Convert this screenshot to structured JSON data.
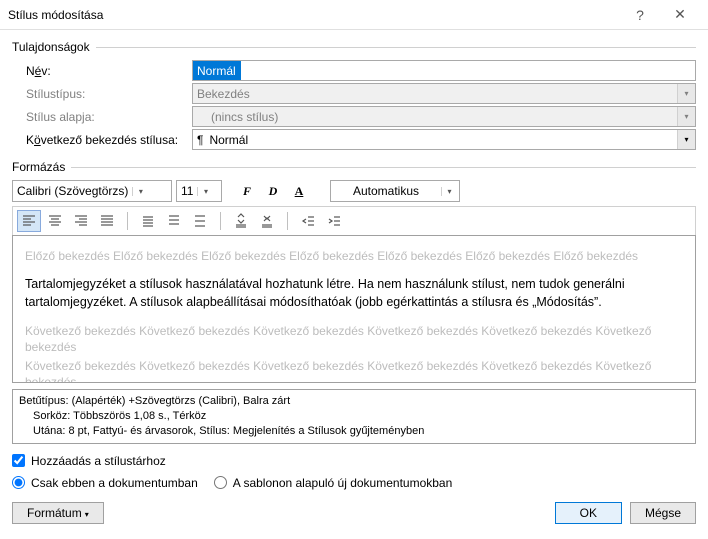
{
  "titlebar": {
    "title": "Stílus módosítása",
    "help": "?",
    "close": "✕"
  },
  "sections": {
    "properties": "Tulajdonságok",
    "formatting": "Formázás"
  },
  "props": {
    "name_label_pre": "N",
    "name_label_u": "é",
    "name_label_post": "v:",
    "name_value": "Normál",
    "type_label": "Stílustípus:",
    "type_value": "Bekezdés",
    "based_label": "Stílus alapja:",
    "based_value": "(nincs stílus)",
    "next_label_pre": "K",
    "next_label_u": "ö",
    "next_label_post": "vetkező bekezdés stílusa:",
    "next_value": "Normál"
  },
  "toolbar": {
    "font": "Calibri (Szövegtörzs)",
    "size": "11",
    "bold": "F",
    "italic": "D",
    "underline": "A",
    "auto": "Automatikus"
  },
  "preview": {
    "prev_line": "Előző bekezdés Előző bekezdés Előző bekezdés Előző bekezdés Előző bekezdés Előző bekezdés Előző bekezdés",
    "live": "Tartalomjegyzéket a stílusok használatával hozhatunk létre. Ha nem használunk stílust, nem tudok generálni tartalomjegyzéket. A stílusok alapbeállításai módosíthatóak (jobb egérkattintás a stílusra és „Módosítás”.",
    "next_line1": "Következő bekezdés Következő bekezdés Következő bekezdés Következő bekezdés Következő bekezdés Következő bekezdés",
    "next_line2": "Következő bekezdés Következő bekezdés Következő bekezdés Következő bekezdés Következő bekezdés Következő bekezdés"
  },
  "desc": {
    "line1": "Betűtípus: (Alapérték) +Szövegtörzs (Calibri), Balra zárt",
    "line2": "Sorköz:  Többszörös 1,08 s., Térköz",
    "line3": "Utána:  8 pt, Fattyú- és árvasorok, Stílus: Megjelenítés a Stílusok gyűjteményben"
  },
  "opts": {
    "add_pre": "Hozzá",
    "add_u": "a",
    "add_post": "dás a stílustárhoz",
    "only_doc": "Csak ebben a dokumentumban",
    "template": "A sablonon alapuló új dokumentumokban"
  },
  "buttons": {
    "format_pre": "Formátu",
    "format_u": "m",
    "ok": "OK",
    "cancel": "Mégse"
  }
}
